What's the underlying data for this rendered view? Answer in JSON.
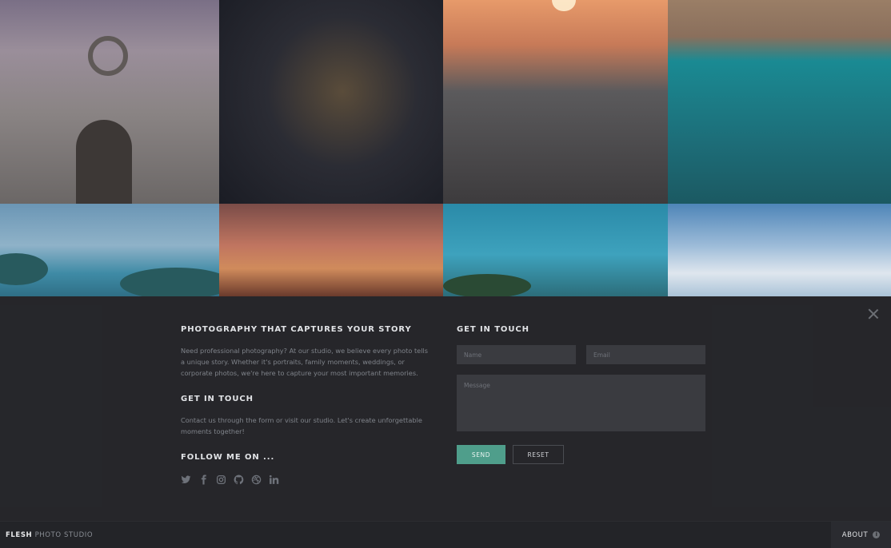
{
  "panel": {
    "section1_title": "PHOTOGRAPHY THAT CAPTURES YOUR STORY",
    "section1_text": "Need professional photography? At our studio, we believe every photo tells a unique story. Whether it's portraits, family moments, weddings, or corporate photos, we're here to capture your most important memories.",
    "section2_title": "GET IN TOUCH",
    "section2_text": "Contact us through the form or visit our studio. Let's create unforgettable moments together!",
    "section3_title": "FOLLOW ME ON ...",
    "social_icons": [
      "twitter-icon",
      "facebook-icon",
      "instagram-icon",
      "github-icon",
      "dribbble-icon",
      "linkedin-icon"
    ]
  },
  "contact_form": {
    "title": "GET IN TOUCH",
    "name_placeholder": "Name",
    "email_placeholder": "Email",
    "message_placeholder": "Message",
    "send_label": "SEND",
    "reset_label": "RESET"
  },
  "footer": {
    "brand_bold": "FLESH",
    "brand_light": "PHOTO STUDIO",
    "about_label": "ABOUT",
    "info_glyph": "i"
  },
  "colors": {
    "accent": "#4f9e8b",
    "panel_bg": "#26272b",
    "footer_bg": "#232428"
  }
}
